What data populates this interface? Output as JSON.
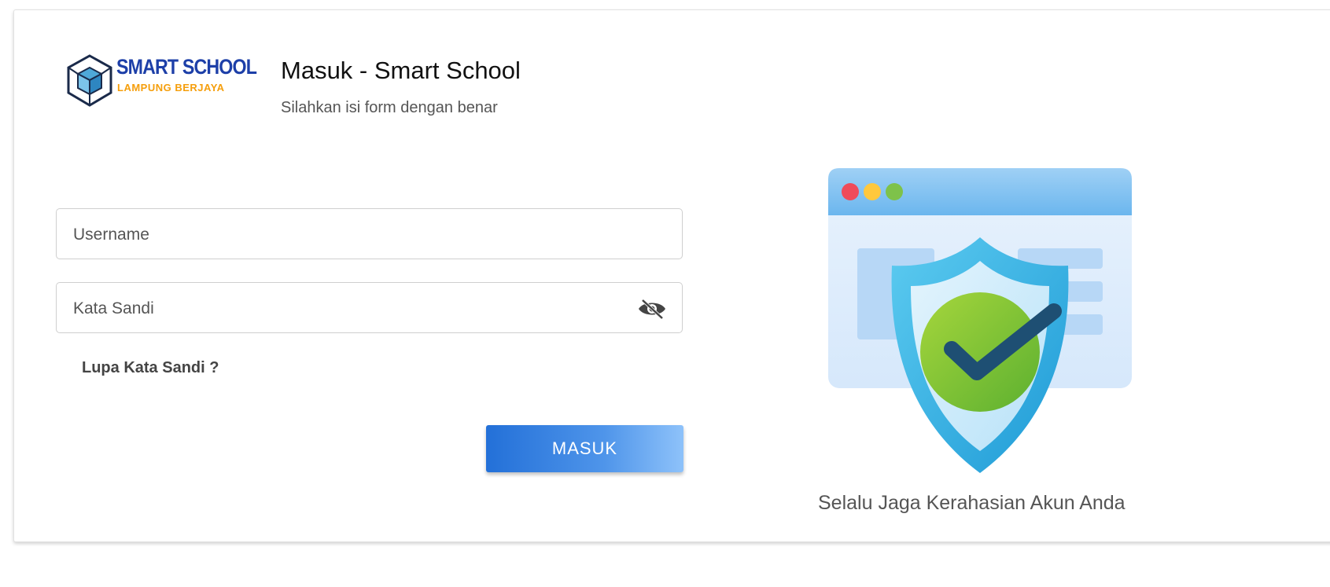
{
  "header": {
    "logo": {
      "line1": "SMART SCHOOL",
      "line2": "LAMPUNG BERJAYA"
    },
    "title": "Masuk - Smart School",
    "subtitle": "Silahkan isi form dengan benar"
  },
  "form": {
    "username": {
      "placeholder": "Username",
      "value": ""
    },
    "password": {
      "placeholder": "Kata Sandi",
      "value": "",
      "toggle_icon": "eye-off-icon"
    },
    "forgot_label": "Lupa Kata Sandi ?",
    "submit_label": "MASUK"
  },
  "illustration": {
    "icon": "shield-check-icon",
    "caption": "Selalu Jaga Kerahasian Akun Anda"
  },
  "colors": {
    "primary": "#2370d8",
    "logo_blue": "#1d3fa8",
    "logo_orange": "#f59e0b",
    "shield": "#3db8e8",
    "check": "#8bc34a"
  }
}
